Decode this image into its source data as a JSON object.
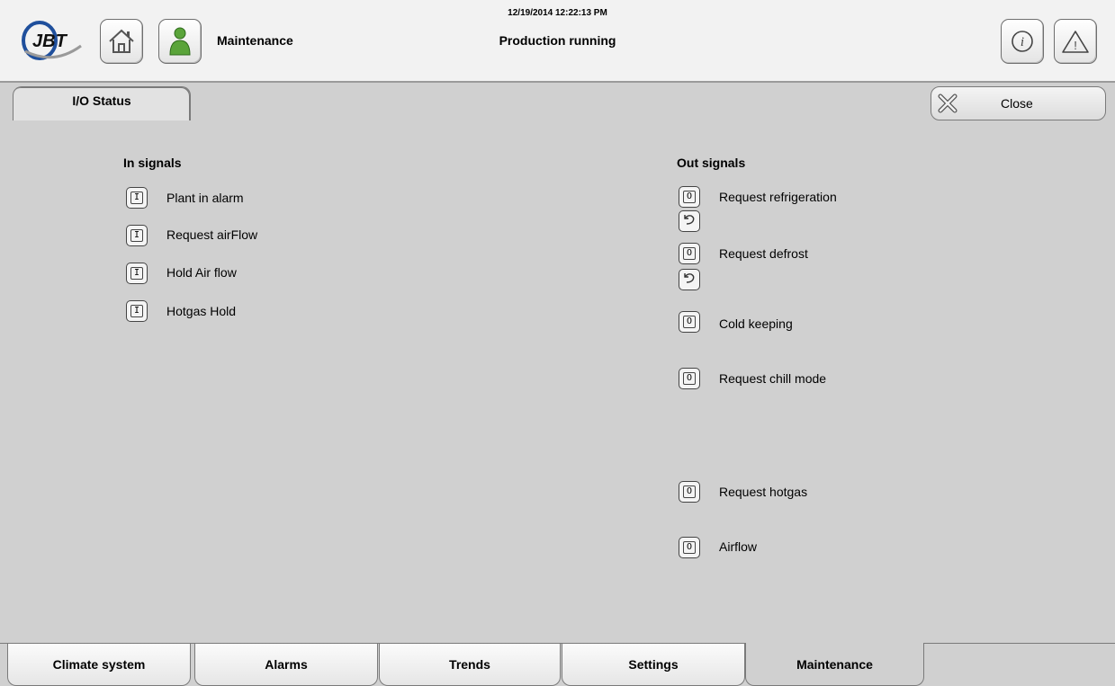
{
  "header": {
    "logo_text": "JBT",
    "role_label": "Maintenance",
    "datetime": "12/19/2014 12:22:13 PM",
    "status": "Production running",
    "icons": [
      "home-icon",
      "user-icon",
      "info-icon",
      "warning-icon"
    ]
  },
  "page": {
    "title": "I/O Status",
    "close_label": "Close"
  },
  "in_signals": {
    "title": "In signals",
    "icon_glyph": "I",
    "items": [
      {
        "label": "Plant in alarm"
      },
      {
        "label": "Request airFlow"
      },
      {
        "label": "Hold Air flow"
      },
      {
        "label": "Hotgas Hold"
      }
    ]
  },
  "out_signals": {
    "title": "Out signals",
    "icon_glyph": "O",
    "items": [
      {
        "label": "Request refrigeration",
        "has_reset": true
      },
      {
        "label": "Request defrost",
        "has_reset": true
      },
      {
        "label": "Cold keeping",
        "has_reset": false
      },
      {
        "label": "Request chill mode",
        "has_reset": false
      },
      {
        "label": "Request hotgas",
        "has_reset": false
      },
      {
        "label": "Airflow",
        "has_reset": false
      }
    ]
  },
  "nav": {
    "tabs": [
      {
        "label": "Climate system",
        "active": false
      },
      {
        "label": "Alarms",
        "active": false
      },
      {
        "label": "Trends",
        "active": false
      },
      {
        "label": "Settings",
        "active": false
      },
      {
        "label": "Maintenance",
        "active": true
      }
    ]
  },
  "colors": {
    "background": "#d0d0d0",
    "header": "#f2f2f2",
    "logo_blue": "#1f4f9c",
    "user_green": "#5aa43a"
  }
}
